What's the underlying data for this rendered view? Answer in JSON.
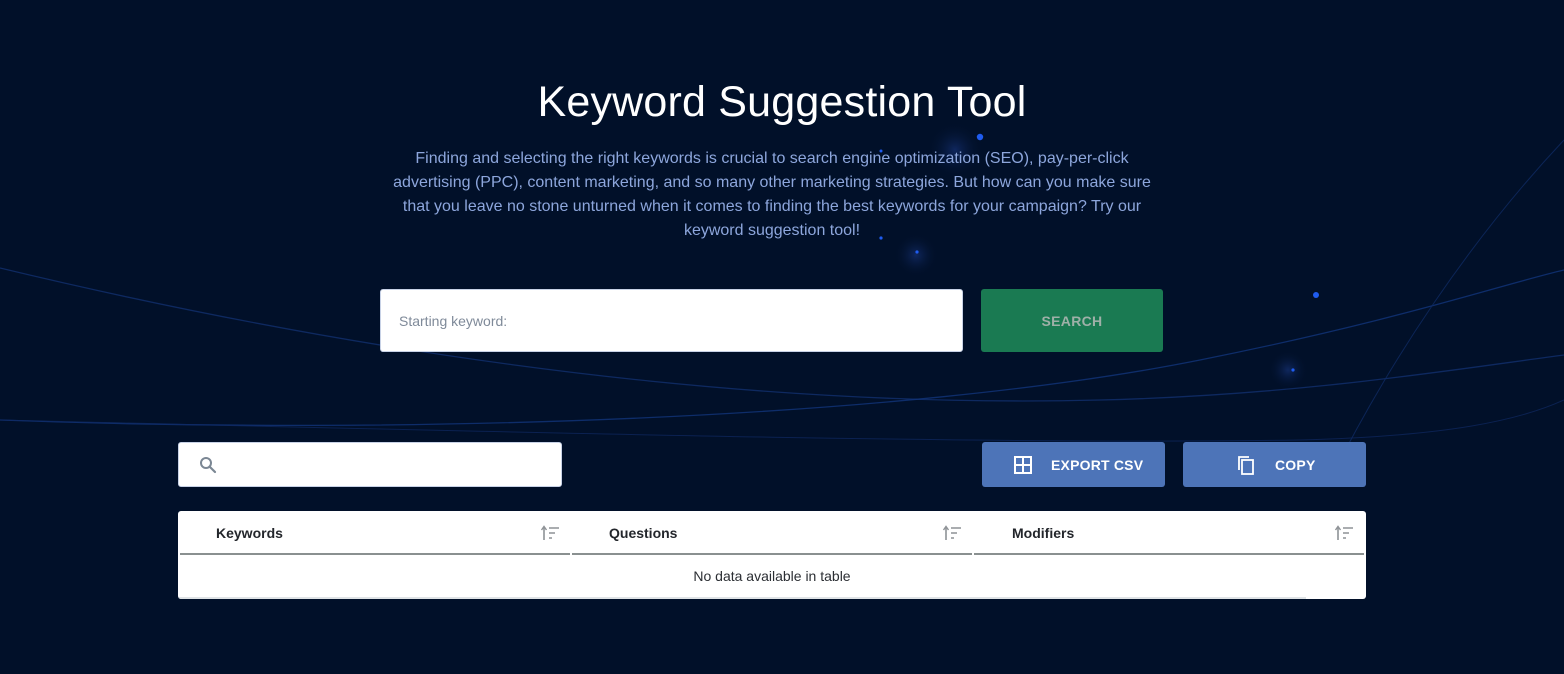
{
  "header": {
    "title": "Keyword Suggestion Tool",
    "description": "Finding and selecting the right keywords is crucial to search engine optimization (SEO), pay-per-click advertising (PPC), content marketing, and so many other marketing strategies. But how can you make sure that you leave no stone unturned when it comes to finding the best keywords for your campaign? Try our keyword suggestion tool!"
  },
  "search_form": {
    "keyword_input": {
      "value": "",
      "placeholder": "Starting keyword:"
    },
    "search_button_label": "SEARCH"
  },
  "toolbar": {
    "filter_input": {
      "value": "",
      "placeholder": "",
      "icon": "search-icon"
    },
    "export_button": {
      "label": "EXPORT CSV",
      "icon": "grid-icon"
    },
    "copy_button": {
      "label": "COPY",
      "icon": "copy-icon"
    }
  },
  "table": {
    "columns": [
      {
        "label": "Keywords",
        "sort_icon": "sort-icon"
      },
      {
        "label": "Questions",
        "sort_icon": "sort-icon"
      },
      {
        "label": "Modifiers",
        "sort_icon": "sort-icon"
      }
    ],
    "rows": [],
    "empty_message": "No data available in table"
  },
  "colors": {
    "background": "#011029",
    "search_button": "#1a7a52",
    "action_button": "#4d74b8",
    "description_text": "#8da6dc",
    "accent_dot": "#1f5cf0"
  }
}
